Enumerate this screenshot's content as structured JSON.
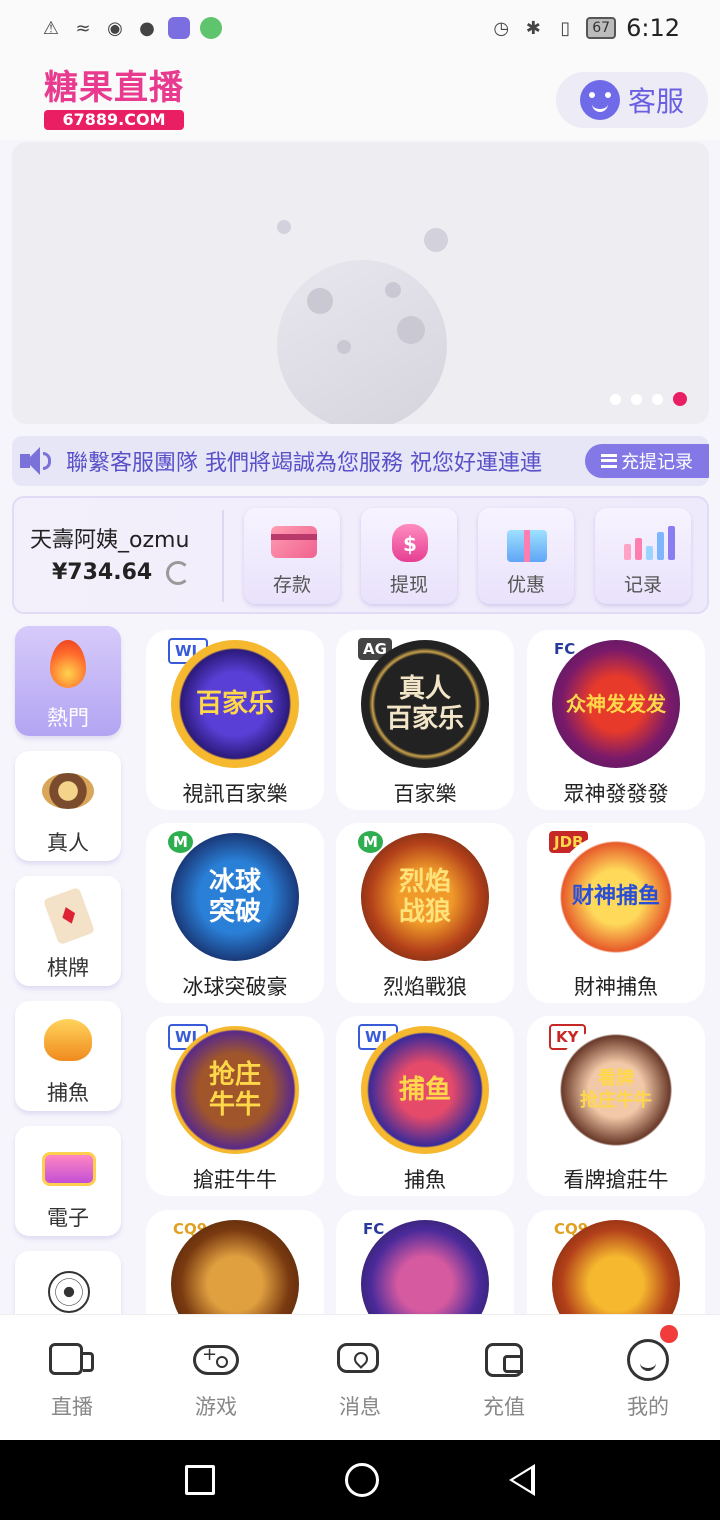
{
  "status_bar": {
    "time": "6:12",
    "battery": "67",
    "left_icons": [
      "alert-icon",
      "wifi-icon",
      "eye-icon",
      "qq-icon",
      "app-icon",
      "chat-app-icon"
    ],
    "right_icons": [
      "alarm-icon",
      "bluetooth-icon",
      "vibrate-icon"
    ]
  },
  "header": {
    "logo_text": "糖果直播",
    "logo_domain": "67889.COM",
    "service_label": "客服"
  },
  "banner": {
    "dot_count": 4,
    "active_dot": 3
  },
  "marquee": {
    "text": "聯繫客服團隊 我們將竭誠為您服務 祝您好運連連",
    "record_button": "充提记录"
  },
  "account": {
    "username": "天壽阿姨_ozmu",
    "balance": "¥734.64",
    "actions": [
      {
        "label": "存款",
        "icon": "deposit-card-icon"
      },
      {
        "label": "提现",
        "icon": "money-bag-icon"
      },
      {
        "label": "优惠",
        "icon": "gift-box-icon"
      },
      {
        "label": "记录",
        "icon": "bar-chart-icon"
      }
    ]
  },
  "categories": [
    {
      "label": "熱門",
      "icon": "flame-icon",
      "active": true
    },
    {
      "label": "真人",
      "icon": "casino-chip-icon"
    },
    {
      "label": "棋牌",
      "icon": "playing-card-icon"
    },
    {
      "label": "捕魚",
      "icon": "shark-icon"
    },
    {
      "label": "電子",
      "icon": "slot-machine-icon"
    },
    {
      "label": "",
      "icon": "soccer-ball-icon"
    }
  ],
  "games": [
    {
      "label": "視訊百家樂",
      "provider": "WL",
      "art": "百家乐"
    },
    {
      "label": "百家樂",
      "provider": "AG",
      "art": "真人\n百家乐"
    },
    {
      "label": "眾神發發發",
      "provider": "FC",
      "art": "众神发发发"
    },
    {
      "label": "冰球突破豪",
      "provider": "M",
      "art": "冰球\n突破"
    },
    {
      "label": "烈焰戰狼",
      "provider": "M",
      "art": "烈焰\n战狼"
    },
    {
      "label": "財神捕魚",
      "provider": "JDB",
      "art": "财神捕鱼"
    },
    {
      "label": "搶莊牛牛",
      "provider": "WL",
      "art": "抢庄\n牛牛"
    },
    {
      "label": "捕魚",
      "provider": "WL",
      "art": "捕鱼"
    },
    {
      "label": "看牌搶莊牛",
      "provider": "KY",
      "art": "看牌\n抢庄牛牛"
    },
    {
      "label": "",
      "provider": "CQ9",
      "art": ""
    },
    {
      "label": "",
      "provider": "FC",
      "art": ""
    },
    {
      "label": "",
      "provider": "CQ9",
      "art": ""
    }
  ],
  "bottom_nav": [
    {
      "label": "直播",
      "icon": "live-tv-icon"
    },
    {
      "label": "游戏",
      "icon": "gamepad-icon"
    },
    {
      "label": "消息",
      "icon": "chat-bubble-icon"
    },
    {
      "label": "充值",
      "icon": "wallet-icon"
    },
    {
      "label": "我的",
      "icon": "smiley-face-icon",
      "badge": true
    }
  ],
  "colors": {
    "brand_pink": "#e91e63",
    "accent_purple": "#8478e6",
    "background": "#f6f5fb"
  }
}
